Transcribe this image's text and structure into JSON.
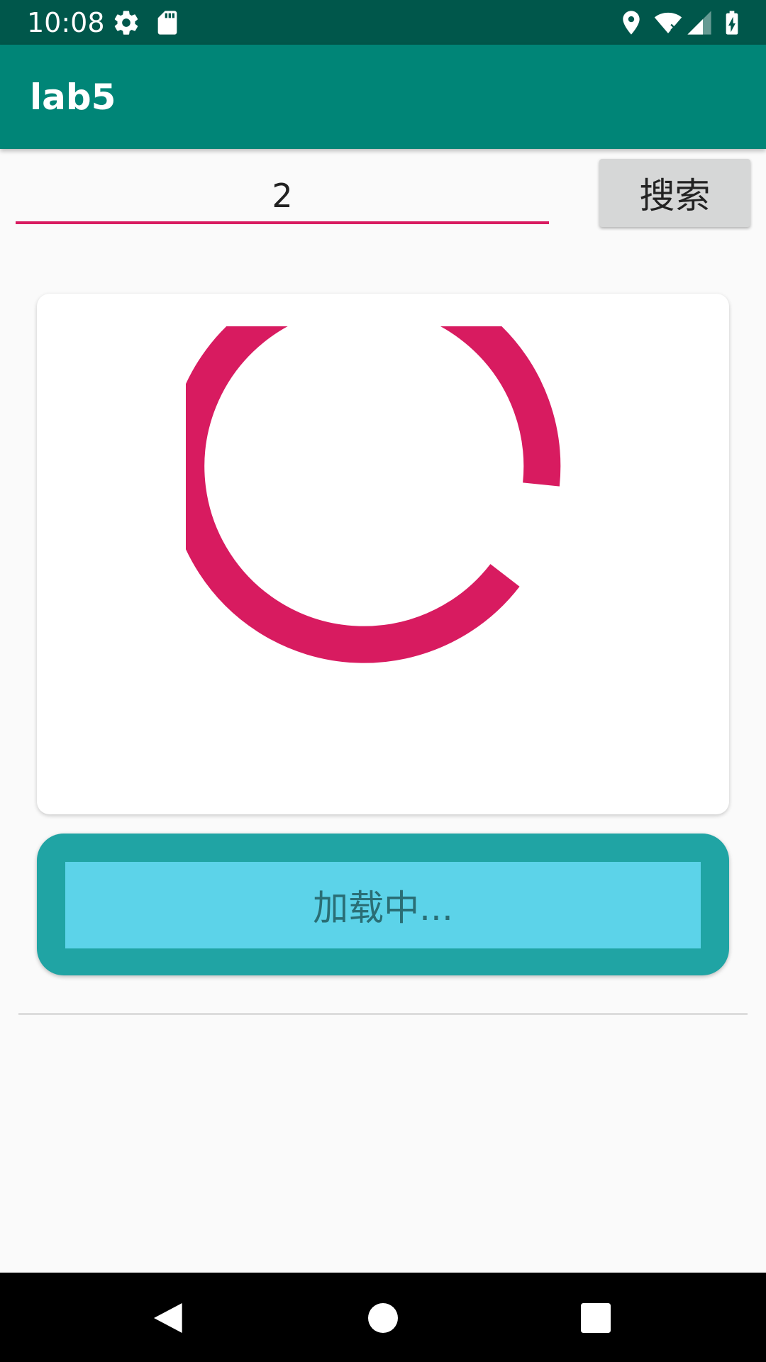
{
  "status_bar": {
    "time": "10:08",
    "icons": [
      "settings-icon",
      "sd-card-icon",
      "location-icon",
      "wifi-icon",
      "signal-icon",
      "battery-charging-icon"
    ]
  },
  "app_bar": {
    "title": "lab5"
  },
  "search": {
    "value": "2",
    "button_label": "搜索"
  },
  "loading": {
    "label": "加载中..."
  },
  "colors": {
    "status_bar": "#00574b",
    "app_bar": "#008577",
    "accent": "#d81b60",
    "panel_outer": "#20a4a4",
    "panel_inner": "#5cd3e9"
  },
  "nav_bar": {
    "icons": [
      "back-icon",
      "home-icon",
      "recents-icon"
    ]
  }
}
